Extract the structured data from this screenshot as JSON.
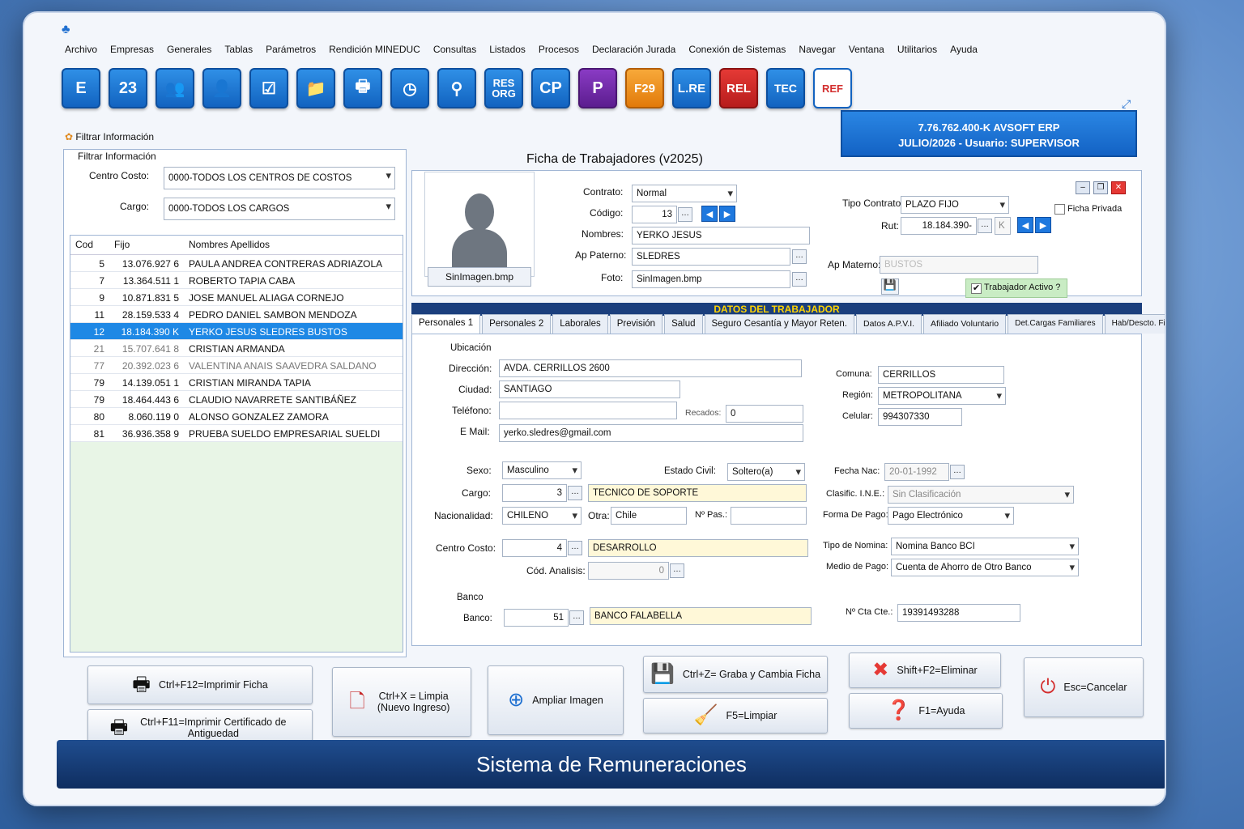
{
  "menu": [
    "Archivo",
    "Empresas",
    "Generales",
    "Tablas",
    "Parámetros",
    "Rendición MINEDUC",
    "Consultas",
    "Listados",
    "Procesos",
    "Declaración Jurada",
    "Conexión de Sistemas",
    "Navegar",
    "Ventana",
    "Utilitarios",
    "Ayuda"
  ],
  "toolbar": {
    "e_label": "E",
    "cal_label": "23",
    "res_label": "RES\nORG",
    "cp_label": "CP",
    "p_label": "P",
    "f29_label": "F29",
    "lre_label": "L.RE",
    "rel_label": "REL",
    "tec_label": "TEC",
    "ref_label": "REF"
  },
  "company": {
    "line1": "7.76.762.400-K  AVSOFT ERP",
    "line2": "JULIO/2026  -  Usuario: SUPERVISOR"
  },
  "filter": {
    "header": "Filtrar Información",
    "group": "Filtrar Información",
    "centro_label": "Centro Costo:",
    "centro_value": "0000-TODOS LOS CENTROS DE COSTOS",
    "cargo_label": "Cargo:",
    "cargo_value": "0000-TODOS LOS CARGOS"
  },
  "grid": {
    "headers": [
      "Cod",
      "Fijo",
      "Nombres Apellidos"
    ],
    "rows": [
      [
        "5",
        "13.076.927 6",
        "PAULA ANDREA CONTRERAS ADRIAZOLA"
      ],
      [
        "7",
        "13.364.511 1",
        "ROBERTO TAPIA CABA"
      ],
      [
        "9",
        "10.871.831 5",
        "JOSE MANUEL ALIAGA CORNEJO"
      ],
      [
        "11",
        "28.159.533 4",
        "PEDRO DANIEL SAMBON MENDOZA"
      ],
      [
        "12",
        "18.184.390 K",
        "YERKO JESUS SLEDRES BUSTOS"
      ],
      [
        "21",
        "15.707.641 8",
        "CRISTIAN ARMANDA"
      ],
      [
        "77",
        "20.392.023 6",
        "VALENTINA ANAIS SAAVEDRA SALDANO"
      ],
      [
        "79",
        "14.139.051 1",
        "CRISTIAN MIRANDA TAPIA"
      ],
      [
        "79",
        "18.464.443 6",
        "CLAUDIO NAVARRETE SANTIBÁÑEZ"
      ],
      [
        "80",
        "8.060.119 0",
        "ALONSO GONZALEZ ZAMORA"
      ],
      [
        "81",
        "36.936.358 9",
        "PRUEBA SUELDO EMPRESARIAL SUELDI"
      ]
    ]
  },
  "title": "Ficha de Trabajadores (v2025)",
  "photo": {
    "caption": "SinImagen.bmp"
  },
  "ficha": {
    "contrato_label": "Contrato:",
    "contrato": "Normal",
    "codigo_label": "Código:",
    "codigo": "13",
    "nombres_label": "Nombres:",
    "nombres": "YERKO JESUS",
    "appat_label": "Ap Paterno:",
    "appat": "SLEDRES",
    "foto_label": "Foto:",
    "foto": "SinImagen.bmp",
    "tipo_label": "Tipo Contrato:",
    "tipo": "PLAZO FIJO",
    "rut_label": "Rut:",
    "rut": "18.184.390-",
    "rut_dv": "K",
    "apmat_label": "Ap Materno:",
    "apmat": "BUSTOS",
    "privada_label": "Ficha Privada",
    "activo_label": "Trabajador Activo ?"
  },
  "banner": "DATOS DEL TRABAJADOR",
  "tabs": [
    "Personales 1",
    "Personales 2",
    "Laborales",
    "Previsión",
    "Salud",
    "Seguro Cesantía y Mayor Reten.",
    "Datos A.P.V.I.",
    "Afiliado Voluntario",
    "Det.Cargas Familiares",
    "Hab/Descto. Fijo"
  ],
  "p1": {
    "ubicacion": "Ubicación",
    "direccion_label": "Dirección:",
    "direccion": "AVDA. CERRILLOS 2600",
    "ciudad_label": "Ciudad:",
    "ciudad": "SANTIAGO",
    "telefono_label": "Teléfono:",
    "recados_label": "Recados:",
    "recados": "0",
    "email_label": "E Mail:",
    "email": "yerko.sledres@gmail.com",
    "comuna_label": "Comuna:",
    "comuna": "CERRILLOS",
    "region_label": "Región:",
    "region": "METROPOLITANA",
    "celular_label": "Celular:",
    "celular": "994307330",
    "sexo_label": "Sexo:",
    "sexo": "Masculino",
    "civil_label": "Estado Civil:",
    "civil": "Soltero(a)",
    "nac_label": "Fecha Nac:",
    "nac": "20-01-1992",
    "cargo_label": "Cargo:",
    "cargo_code": "3",
    "cargo": "TECNICO DE SOPORTE",
    "ine_label": "Clasific. I.N.E.:",
    "ine": "Sin Clasificación",
    "nacion_label": "Nacionalidad:",
    "nacion": "CHILENO",
    "otra_label": "Otra:",
    "otra": "Chile",
    "pas_label": "Nº Pas.:",
    "pago_label": "Forma De Pago:",
    "pago": "Pago Electrónico",
    "cc_label": "Centro Costo:",
    "cc_code": "4",
    "cc": "DESARROLLO",
    "nomina_label": "Tipo de Nomina:",
    "nomina": "Nomina Banco BCI",
    "analisis_label": "Cód. Analisis:",
    "analisis": "0",
    "medio_label": "Medio de Pago:",
    "medio": "Cuenta de Ahorro de Otro Banco",
    "banco_group": "Banco",
    "banco_label": "Banco:",
    "banco_code": "51",
    "banco": "BANCO FALABELLA",
    "cta_label": "Nº Cta Cte.:",
    "cta": "19391493288"
  },
  "buttons": {
    "imprimir": "Ctrl+F12=Imprimir Ficha",
    "certificado": "Ctrl+F11=Imprimir Certificado de Antiguedad",
    "limpia": "Ctrl+X = Limpia (Nuevo Ingreso)",
    "ampliar": "Ampliar Imagen",
    "graba": "Ctrl+Z= Graba y Cambia Ficha",
    "limpiar": "F5=Limpiar",
    "eliminar": "Shift+F2=Eliminar",
    "ayuda": "F1=Ayuda",
    "cancelar": "Esc=Cancelar"
  },
  "footer": "Sistema de Remuneraciones",
  "colors": {
    "accent": "#1e88e5",
    "banner": "#1b3f7d",
    "banner_text": "#ffd400"
  }
}
